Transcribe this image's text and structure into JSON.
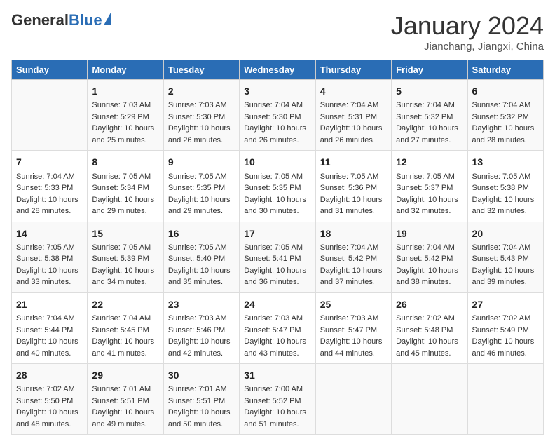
{
  "logo": {
    "general": "General",
    "blue": "Blue"
  },
  "title": "January 2024",
  "location": "Jianchang, Jiangxi, China",
  "days_of_week": [
    "Sunday",
    "Monday",
    "Tuesday",
    "Wednesday",
    "Thursday",
    "Friday",
    "Saturday"
  ],
  "weeks": [
    [
      {
        "day": "",
        "info": ""
      },
      {
        "day": "1",
        "info": "Sunrise: 7:03 AM\nSunset: 5:29 PM\nDaylight: 10 hours\nand 25 minutes."
      },
      {
        "day": "2",
        "info": "Sunrise: 7:03 AM\nSunset: 5:30 PM\nDaylight: 10 hours\nand 26 minutes."
      },
      {
        "day": "3",
        "info": "Sunrise: 7:04 AM\nSunset: 5:30 PM\nDaylight: 10 hours\nand 26 minutes."
      },
      {
        "day": "4",
        "info": "Sunrise: 7:04 AM\nSunset: 5:31 PM\nDaylight: 10 hours\nand 26 minutes."
      },
      {
        "day": "5",
        "info": "Sunrise: 7:04 AM\nSunset: 5:32 PM\nDaylight: 10 hours\nand 27 minutes."
      },
      {
        "day": "6",
        "info": "Sunrise: 7:04 AM\nSunset: 5:32 PM\nDaylight: 10 hours\nand 28 minutes."
      }
    ],
    [
      {
        "day": "7",
        "info": "Sunrise: 7:04 AM\nSunset: 5:33 PM\nDaylight: 10 hours\nand 28 minutes."
      },
      {
        "day": "8",
        "info": "Sunrise: 7:05 AM\nSunset: 5:34 PM\nDaylight: 10 hours\nand 29 minutes."
      },
      {
        "day": "9",
        "info": "Sunrise: 7:05 AM\nSunset: 5:35 PM\nDaylight: 10 hours\nand 29 minutes."
      },
      {
        "day": "10",
        "info": "Sunrise: 7:05 AM\nSunset: 5:35 PM\nDaylight: 10 hours\nand 30 minutes."
      },
      {
        "day": "11",
        "info": "Sunrise: 7:05 AM\nSunset: 5:36 PM\nDaylight: 10 hours\nand 31 minutes."
      },
      {
        "day": "12",
        "info": "Sunrise: 7:05 AM\nSunset: 5:37 PM\nDaylight: 10 hours\nand 32 minutes."
      },
      {
        "day": "13",
        "info": "Sunrise: 7:05 AM\nSunset: 5:38 PM\nDaylight: 10 hours\nand 32 minutes."
      }
    ],
    [
      {
        "day": "14",
        "info": "Sunrise: 7:05 AM\nSunset: 5:38 PM\nDaylight: 10 hours\nand 33 minutes."
      },
      {
        "day": "15",
        "info": "Sunrise: 7:05 AM\nSunset: 5:39 PM\nDaylight: 10 hours\nand 34 minutes."
      },
      {
        "day": "16",
        "info": "Sunrise: 7:05 AM\nSunset: 5:40 PM\nDaylight: 10 hours\nand 35 minutes."
      },
      {
        "day": "17",
        "info": "Sunrise: 7:05 AM\nSunset: 5:41 PM\nDaylight: 10 hours\nand 36 minutes."
      },
      {
        "day": "18",
        "info": "Sunrise: 7:04 AM\nSunset: 5:42 PM\nDaylight: 10 hours\nand 37 minutes."
      },
      {
        "day": "19",
        "info": "Sunrise: 7:04 AM\nSunset: 5:42 PM\nDaylight: 10 hours\nand 38 minutes."
      },
      {
        "day": "20",
        "info": "Sunrise: 7:04 AM\nSunset: 5:43 PM\nDaylight: 10 hours\nand 39 minutes."
      }
    ],
    [
      {
        "day": "21",
        "info": "Sunrise: 7:04 AM\nSunset: 5:44 PM\nDaylight: 10 hours\nand 40 minutes."
      },
      {
        "day": "22",
        "info": "Sunrise: 7:04 AM\nSunset: 5:45 PM\nDaylight: 10 hours\nand 41 minutes."
      },
      {
        "day": "23",
        "info": "Sunrise: 7:03 AM\nSunset: 5:46 PM\nDaylight: 10 hours\nand 42 minutes."
      },
      {
        "day": "24",
        "info": "Sunrise: 7:03 AM\nSunset: 5:47 PM\nDaylight: 10 hours\nand 43 minutes."
      },
      {
        "day": "25",
        "info": "Sunrise: 7:03 AM\nSunset: 5:47 PM\nDaylight: 10 hours\nand 44 minutes."
      },
      {
        "day": "26",
        "info": "Sunrise: 7:02 AM\nSunset: 5:48 PM\nDaylight: 10 hours\nand 45 minutes."
      },
      {
        "day": "27",
        "info": "Sunrise: 7:02 AM\nSunset: 5:49 PM\nDaylight: 10 hours\nand 46 minutes."
      }
    ],
    [
      {
        "day": "28",
        "info": "Sunrise: 7:02 AM\nSunset: 5:50 PM\nDaylight: 10 hours\nand 48 minutes."
      },
      {
        "day": "29",
        "info": "Sunrise: 7:01 AM\nSunset: 5:51 PM\nDaylight: 10 hours\nand 49 minutes."
      },
      {
        "day": "30",
        "info": "Sunrise: 7:01 AM\nSunset: 5:51 PM\nDaylight: 10 hours\nand 50 minutes."
      },
      {
        "day": "31",
        "info": "Sunrise: 7:00 AM\nSunset: 5:52 PM\nDaylight: 10 hours\nand 51 minutes."
      },
      {
        "day": "",
        "info": ""
      },
      {
        "day": "",
        "info": ""
      },
      {
        "day": "",
        "info": ""
      }
    ]
  ]
}
